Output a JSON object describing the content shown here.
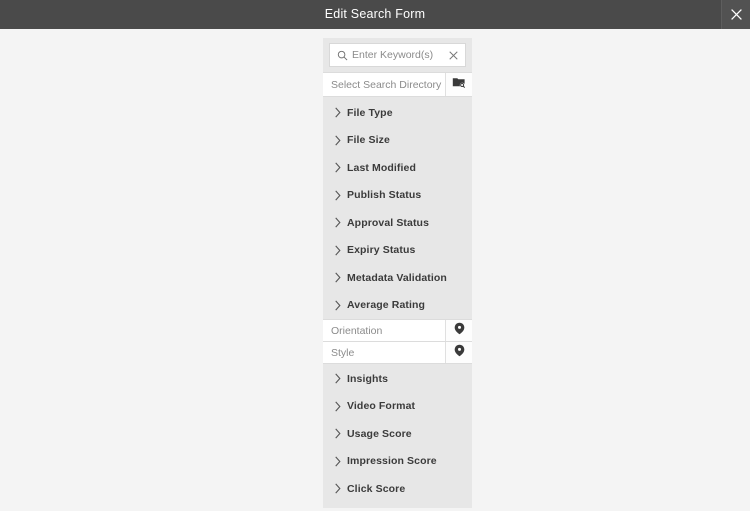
{
  "titlebar": {
    "title": "Edit Search Form",
    "close_label": "×",
    "bg_color": "#4a4a4a",
    "text_color": "#ffffff"
  },
  "panel": {
    "bg_color": "#e7e7e7",
    "keyword_field": {
      "placeholder": "Enter Keyword(s)",
      "value": "",
      "search_icon": "search-icon",
      "clear_icon": "clear-icon"
    },
    "directory_field": {
      "placeholder": "Select Search Directory",
      "value": "",
      "button_icon": "folder-search-icon"
    },
    "accordions_top": [
      {
        "label": "File Type",
        "icon": "chevron-right-icon"
      },
      {
        "label": "File Size",
        "icon": "chevron-right-icon"
      },
      {
        "label": "Last Modified",
        "icon": "chevron-right-icon"
      },
      {
        "label": "Publish Status",
        "icon": "chevron-right-icon"
      },
      {
        "label": "Approval Status",
        "icon": "chevron-right-icon"
      },
      {
        "label": "Expiry Status",
        "icon": "chevron-right-icon"
      },
      {
        "label": "Metadata Validation",
        "icon": "chevron-right-icon"
      },
      {
        "label": "Average Rating",
        "icon": "chevron-right-icon"
      }
    ],
    "tag_fields": [
      {
        "placeholder": "Orientation",
        "value": "",
        "button_icon": "tag-icon"
      },
      {
        "placeholder": "Style",
        "value": "",
        "button_icon": "tag-icon"
      }
    ],
    "accordions_bottom": [
      {
        "label": "Insights",
        "icon": "chevron-right-icon"
      },
      {
        "label": "Video Format",
        "icon": "chevron-right-icon"
      },
      {
        "label": "Usage Score",
        "icon": "chevron-right-icon"
      },
      {
        "label": "Impression Score",
        "icon": "chevron-right-icon"
      },
      {
        "label": "Click Score",
        "icon": "chevron-right-icon"
      }
    ]
  }
}
